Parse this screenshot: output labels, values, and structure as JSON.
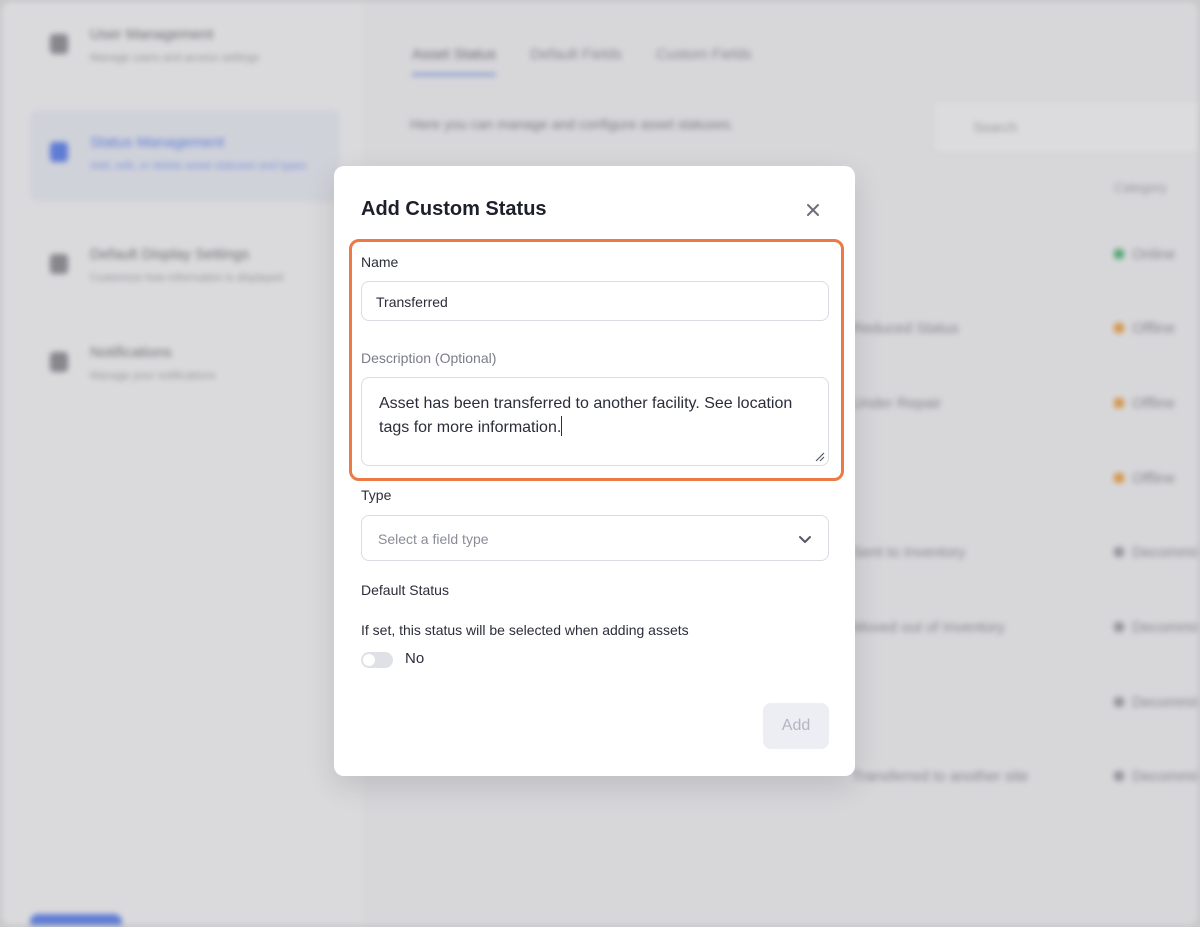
{
  "background": {
    "sidebar": {
      "items": [
        {
          "title": "User Management",
          "subtitle": "Manage users and access settings"
        },
        {
          "title": "Status Management",
          "subtitle": "Add, edit, or delete asset statuses and types"
        },
        {
          "title": "Default Display Settings",
          "subtitle": "Customize how information is displayed"
        },
        {
          "title": "Notifications",
          "subtitle": "Manage your notifications"
        }
      ]
    },
    "tabs": [
      "Asset Status",
      "Default Fields",
      "Custom Fields"
    ],
    "intro_text": "Here you can manage and configure asset statuses.",
    "search_placeholder": "Search",
    "column_header": "Category",
    "rows": [
      {
        "text": "",
        "badge": "Online",
        "color": "#4cae6f"
      },
      {
        "text": "Reduced Status",
        "badge": "Offline",
        "color": "#e89a3a"
      },
      {
        "text": "Under Repair",
        "badge": "Offline",
        "color": "#e89a3a"
      },
      {
        "text": "",
        "badge": "Offline",
        "color": "#e89a3a"
      },
      {
        "text": "Sent to Inventory",
        "badge": "Decommissioned",
        "color": "#9a9aa0"
      },
      {
        "text": "Moved out of Inventory",
        "badge": "Decommissioned",
        "color": "#9a9aa0"
      },
      {
        "text": "",
        "badge": "Decommissioned",
        "color": "#9a9aa0"
      },
      {
        "text": "Transferred to another site",
        "badge": "Decommissioned",
        "color": "#9a9aa0"
      }
    ]
  },
  "modal": {
    "title": "Add Custom Status",
    "close_icon": "close-icon",
    "name_label": "Name",
    "name_value": "Transferred",
    "description_label": "Description (Optional)",
    "description_value": "Asset has been transferred to another facility. See location tags for more information.",
    "type_label": "Type",
    "type_placeholder": "Select a field type",
    "default_status_label": "Default Status",
    "default_status_help": "If set, this status will be selected when adding assets",
    "toggle_state": "No",
    "add_button": "Add"
  },
  "colors": {
    "highlight": "#ec7a45",
    "accent": "#5a7de8"
  }
}
